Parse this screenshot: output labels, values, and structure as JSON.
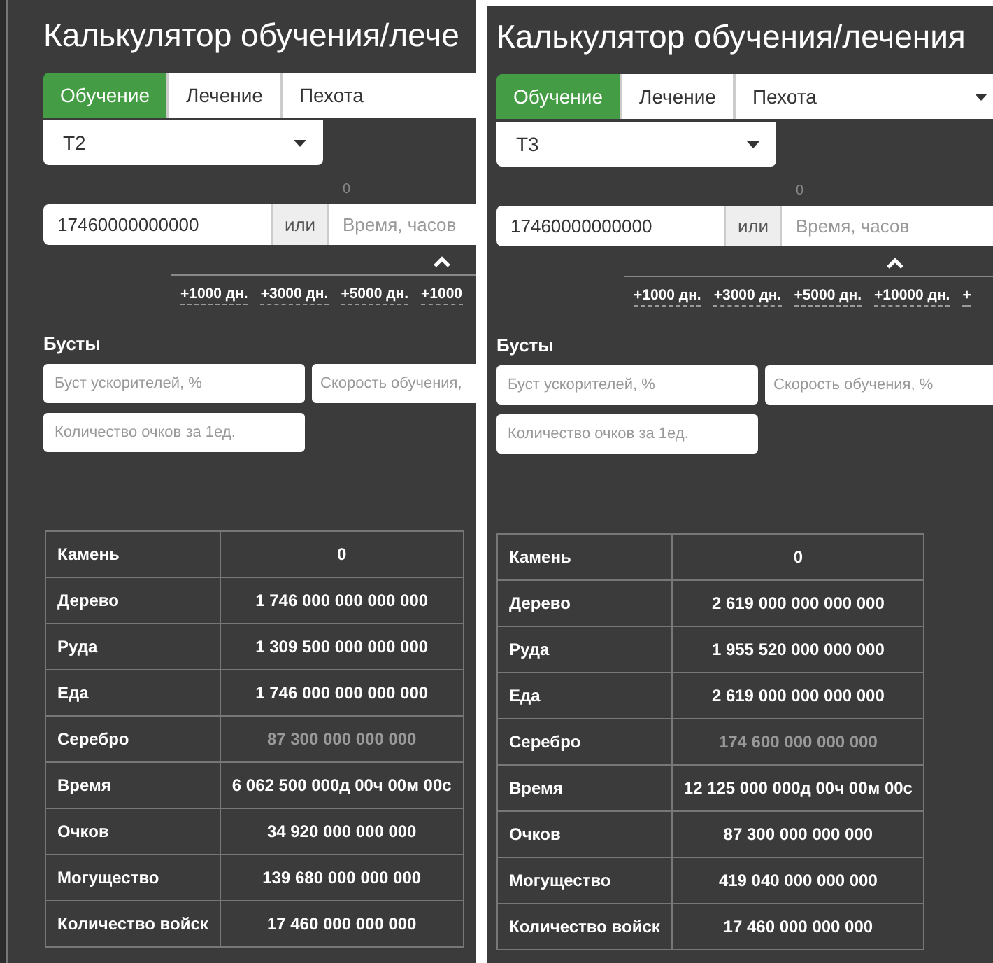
{
  "panels": [
    {
      "title": "Калькулятор обучения/лече",
      "tabs": [
        {
          "label": "Обучение",
          "selected": true
        },
        {
          "label": "Лечение",
          "selected": false
        }
      ],
      "unit_select": {
        "value": "Пехота",
        "caret": false
      },
      "tier_select": {
        "value": "T2"
      },
      "time_hint": "0",
      "amount": {
        "value": "17460000000000"
      },
      "or_label": "или",
      "time_field": {
        "placeholder": "Время, часов"
      },
      "increments": [
        "+1000 дн.",
        "+3000 дн.",
        "+5000 дн.",
        "+1000"
      ],
      "boosts_title": "Бусты",
      "boost_fields": [
        {
          "placeholder": "Буст ускорителей, %"
        },
        {
          "placeholder": "Скорость обучения,"
        },
        {
          "placeholder": "Количество очков за 1ед."
        }
      ],
      "rows": [
        {
          "label": "Камень",
          "value": "0",
          "muted": false
        },
        {
          "label": "Дерево",
          "value": "1 746 000 000 000 000",
          "muted": false
        },
        {
          "label": "Руда",
          "value": "1 309 500 000 000 000",
          "muted": false
        },
        {
          "label": "Еда",
          "value": "1 746 000 000 000 000",
          "muted": false
        },
        {
          "label": "Серебро",
          "value": "87 300 000 000 000",
          "muted": true
        },
        {
          "label": "Время",
          "value": "6 062 500 000д 00ч 00м 00с",
          "muted": false
        },
        {
          "label": "Очков",
          "value": "34 920 000 000 000",
          "muted": false
        },
        {
          "label": "Могущество",
          "value": "139 680 000 000 000",
          "muted": false
        },
        {
          "label": "Количество войск",
          "value": "17 460 000 000 000",
          "muted": false
        }
      ]
    },
    {
      "title": "Калькулятор обучения/лечения",
      "tabs": [
        {
          "label": "Обучение",
          "selected": true
        },
        {
          "label": "Лечение",
          "selected": false
        }
      ],
      "unit_select": {
        "value": "Пехота",
        "caret": true
      },
      "tier_select": {
        "value": "T3"
      },
      "time_hint": "0",
      "amount": {
        "value": "17460000000000"
      },
      "or_label": "или",
      "time_field": {
        "placeholder": "Время, часов"
      },
      "increments": [
        "+1000 дн.",
        "+3000 дн.",
        "+5000 дн.",
        "+10000 дн.",
        "+"
      ],
      "boosts_title": "Бусты",
      "boost_fields": [
        {
          "placeholder": "Буст ускорителей, %"
        },
        {
          "placeholder": "Скорость обучения, %"
        },
        {
          "placeholder": "Количество очков за 1ед."
        }
      ],
      "rows": [
        {
          "label": "Камень",
          "value": "0",
          "muted": false
        },
        {
          "label": "Дерево",
          "value": "2 619 000 000 000 000",
          "muted": false
        },
        {
          "label": "Руда",
          "value": "1 955 520 000 000 000",
          "muted": false
        },
        {
          "label": "Еда",
          "value": "2 619 000 000 000 000",
          "muted": false
        },
        {
          "label": "Серебро",
          "value": "174 600 000 000 000",
          "muted": true
        },
        {
          "label": "Время",
          "value": "12 125 000 000д 00ч 00м 00с",
          "muted": false
        },
        {
          "label": "Очков",
          "value": "87 300 000 000 000",
          "muted": false
        },
        {
          "label": "Могущество",
          "value": "419 040 000 000 000",
          "muted": false
        },
        {
          "label": "Количество войск",
          "value": "17 460 000 000 000",
          "muted": false
        }
      ]
    }
  ]
}
